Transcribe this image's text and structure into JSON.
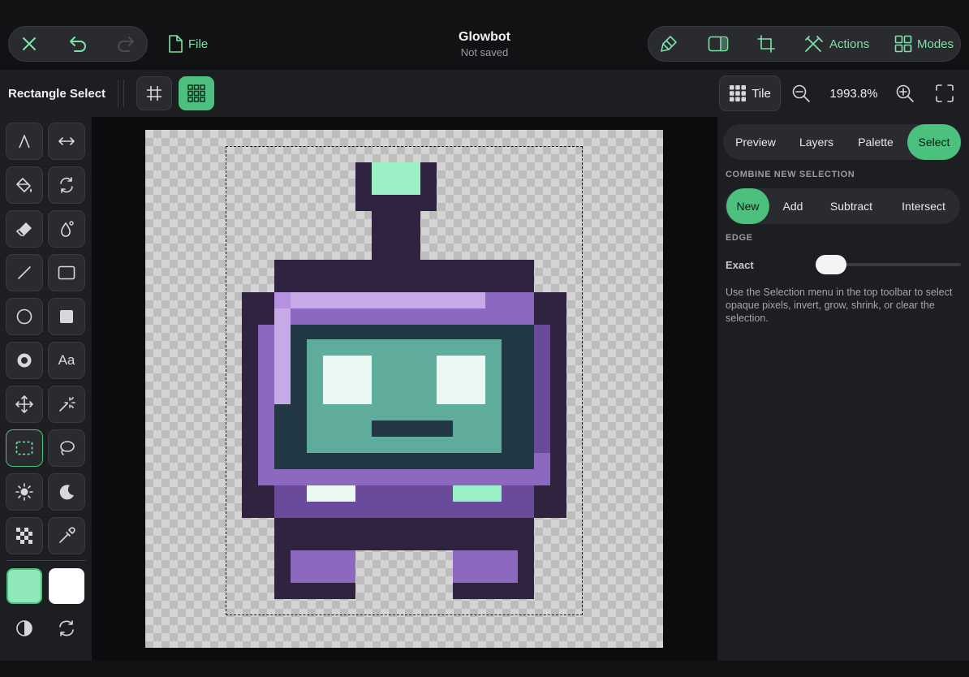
{
  "header": {
    "file_label": "File",
    "title": "Glowbot",
    "status": "Not saved",
    "actions_label": "Actions",
    "modes_label": "Modes"
  },
  "toolbar": {
    "tool_name": "Rectangle Select",
    "tile_label": "Tile",
    "zoom": "1993.8%"
  },
  "tools": [
    "pen-icon",
    "flip-icon",
    "fill-bucket-icon",
    "rotate-icon",
    "eraser-icon",
    "dither-drop-icon",
    "line-icon",
    "rectangle-icon",
    "ellipse-icon",
    "filled-rect-icon",
    "circle-fill-icon",
    "text-icon",
    "move-icon",
    "magic-wand-icon",
    "rect-select-icon",
    "lasso-icon",
    "lighten-icon",
    "darken-icon",
    "checker-icon",
    "eyedropper-icon"
  ],
  "tool_labels": {
    "text": "Aa"
  },
  "colors": {
    "accent": "#4cc07e",
    "primary_swatch": "#8ee8b8",
    "secondary_swatch": "#ffffff"
  },
  "panel": {
    "tabs": [
      {
        "label": "Preview"
      },
      {
        "label": "Layers"
      },
      {
        "label": "Palette"
      },
      {
        "label": "Select"
      }
    ],
    "active_tab": "Select",
    "combine_label": "COMBINE NEW SELECTION",
    "combine_options": [
      {
        "label": "New"
      },
      {
        "label": "Add"
      },
      {
        "label": "Subtract"
      },
      {
        "label": "Intersect"
      }
    ],
    "combine_active": "New",
    "edge_label": "EDGE",
    "edge_value": "Exact",
    "edge_slider_level": 0.0,
    "help_text": "Use the Selection menu in the top toolbar to select opaque pixels, invert, grow, shrink, or clear the selection."
  }
}
